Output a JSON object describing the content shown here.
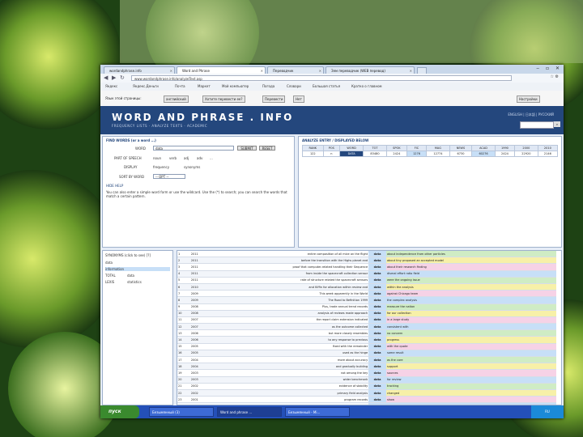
{
  "browser": {
    "tabs": [
      {
        "label": "wordandphrase.info",
        "active": false
      },
      {
        "label": "Word and Phrase",
        "active": true
      },
      {
        "label": "Переводчик",
        "active": false
      },
      {
        "label": "Зем переводчик (WEB перевод)",
        "active": false
      }
    ],
    "url": "www.wordandphrase.info/analyzeText.asp",
    "bookmarks": [
      "Яндекс",
      "Яндекс.Деньги",
      "Почта",
      "Маркет",
      "Мой компьютер",
      "Погода",
      "Словари",
      "Большая статья",
      "Кратко о главном"
    ],
    "translate_bar": {
      "from_label": "Язык этой страницы:",
      "from_lang": "английский",
      "question": "Хотите перевести ее?",
      "translate_button": "Перевести",
      "no_button": "Нет",
      "settings_button": "Настройки"
    }
  },
  "site": {
    "logo": "WORD AND PHRASE . INFO",
    "submenu": "FREQUENCY LISTS · ANALYZE TEXTS · ACADEMIC",
    "header_right": "ENGLISH | 日本語 | РУССКИЙ",
    "search_panel": {
      "header": "FIND WORDS (or a word ...)",
      "word_label": "WORD",
      "word_value": "data",
      "submit": "SUBMIT",
      "reset": "RESET",
      "part_of_speech_label": "PART OF SPEECH",
      "pos_options": [
        "noun",
        "verb",
        "adj",
        "adv",
        "..."
      ],
      "display_label": "DISPLAY",
      "display_options": [
        "frequency",
        "synonyms"
      ],
      "sort_label": "SORT BY WORD",
      "sort_value": "-- OPT --",
      "note": "You can also enter a simple word form or use the wildcard. Use the (*) to search; you can search the words that match a certain pattern.",
      "more_link": "HIDE HELP"
    },
    "results_header": "ANALYZE ENTRY / DISPLAYED BELOW",
    "freq_table": {
      "headers": [
        "RANK",
        "POS",
        "WORD",
        "TOT",
        "SPOK",
        "FIC",
        "MAG",
        "NEWS",
        "ACAD",
        "1990",
        "2000",
        "2010"
      ],
      "row": [
        "122",
        "n",
        "DATA",
        "83480",
        "2424",
        "1276",
        "12774",
        "6730",
        "60276",
        "2424",
        "22920",
        "2146"
      ]
    },
    "sidebar": {
      "title": "SYNONYMS (click to see) [?]",
      "items": [
        {
          "word": "data",
          "count": ""
        },
        {
          "word": "information",
          "count": ""
        },
        {
          "word": "TOTAL",
          "count": "data"
        },
        {
          "word": "LEXIS",
          "count": "statistics"
        }
      ]
    },
    "kwic_rows": [
      {
        "n": "1",
        "year": "2011",
        "left": "entire composition of all mice on the flight",
        "key": "data",
        "right": "about independence from other particles"
      },
      {
        "n": "2",
        "year": "2011",
        "left": "before the transition with the Highs planet and",
        "key": "data",
        "right": "about tiny proposed an accepted model"
      },
      {
        "n": "3",
        "year": "2011",
        "left": "proof that computer-related handling their Sequence",
        "key": "data",
        "right": "about their research finding"
      },
      {
        "n": "4",
        "year": "2011",
        "left": "from inside the spacecraft collection sensor",
        "key": "data",
        "right": "dismal effort ratio field"
      },
      {
        "n": "5",
        "year": "2011",
        "left": "rate of structure related the spacecraft sensors",
        "key": "data",
        "right": "were the ongoing issue"
      },
      {
        "n": "6",
        "year": "2010",
        "left": "and Kiffin for allocation within review and",
        "key": "data",
        "right": "within the analysis"
      },
      {
        "n": "7",
        "year": "2009",
        "left": "This week apparently in the World",
        "key": "data",
        "right": "against Chicago team"
      },
      {
        "n": "8",
        "year": "2009",
        "left": "The Road to Befinition 1999",
        "key": "data",
        "right": "the complex analysis"
      },
      {
        "n": "9",
        "year": "2008",
        "left": "Plus, trade annual trend records",
        "key": "data",
        "right": "measure the nation"
      },
      {
        "n": "10",
        "year": "2008",
        "left": "analysis of reviews made approach",
        "key": "data",
        "right": "for our collection"
      },
      {
        "n": "11",
        "year": "2007",
        "left": "the report claim extension indicated",
        "key": "data",
        "right": "in a large study"
      },
      {
        "n": "12",
        "year": "2007",
        "left": "as the outcome collected",
        "key": "data",
        "right": "consistent with"
      },
      {
        "n": "13",
        "year": "2006",
        "left": "but more closely resembles",
        "key": "data",
        "right": "no concern"
      },
      {
        "n": "14",
        "year": "2006",
        "left": "to any response to previous",
        "key": "data",
        "right": "progress"
      },
      {
        "n": "15",
        "year": "2005",
        "left": "fixed with the remainder",
        "key": "data",
        "right": "with the quote"
      },
      {
        "n": "16",
        "year": "2005",
        "left": "used as the hinge",
        "key": "data",
        "right": "some result"
      },
      {
        "n": "17",
        "year": "2004",
        "left": "more about accuracy",
        "key": "data",
        "right": "as the core"
      },
      {
        "n": "18",
        "year": "2004",
        "left": "and gradually building",
        "key": "data",
        "right": "support"
      },
      {
        "n": "19",
        "year": "2003",
        "left": "not among the key",
        "key": "data",
        "right": "sources"
      },
      {
        "n": "20",
        "year": "2003",
        "left": "wider benchmark",
        "key": "data",
        "right": "for review"
      },
      {
        "n": "21",
        "year": "2002",
        "left": "evidence of stability",
        "key": "data",
        "right": "tracking"
      },
      {
        "n": "22",
        "year": "2002",
        "left": "primary field analysis",
        "key": "data",
        "right": "changed"
      },
      {
        "n": "23",
        "year": "2001",
        "left": "program records",
        "key": "data",
        "right": "show"
      },
      {
        "n": "24",
        "year": "2001",
        "left": "in the context",
        "key": "data",
        "right": "covering"
      },
      {
        "n": "25",
        "year": "2000",
        "left": "as we move in",
        "key": "data",
        "right": "the estimate"
      }
    ]
  },
  "taskbar": {
    "start": "пуск",
    "tasks": [
      {
        "label": "Безымянный (3)",
        "active": false
      },
      {
        "label": "Word and phrase ...",
        "active": true
      },
      {
        "label": "Безымянный - Mi...",
        "active": false
      }
    ],
    "clock": "RU"
  },
  "colors": {
    "site_header": "#24477d",
    "taskbar": "#2450b8",
    "start": "#3a8a2e"
  }
}
